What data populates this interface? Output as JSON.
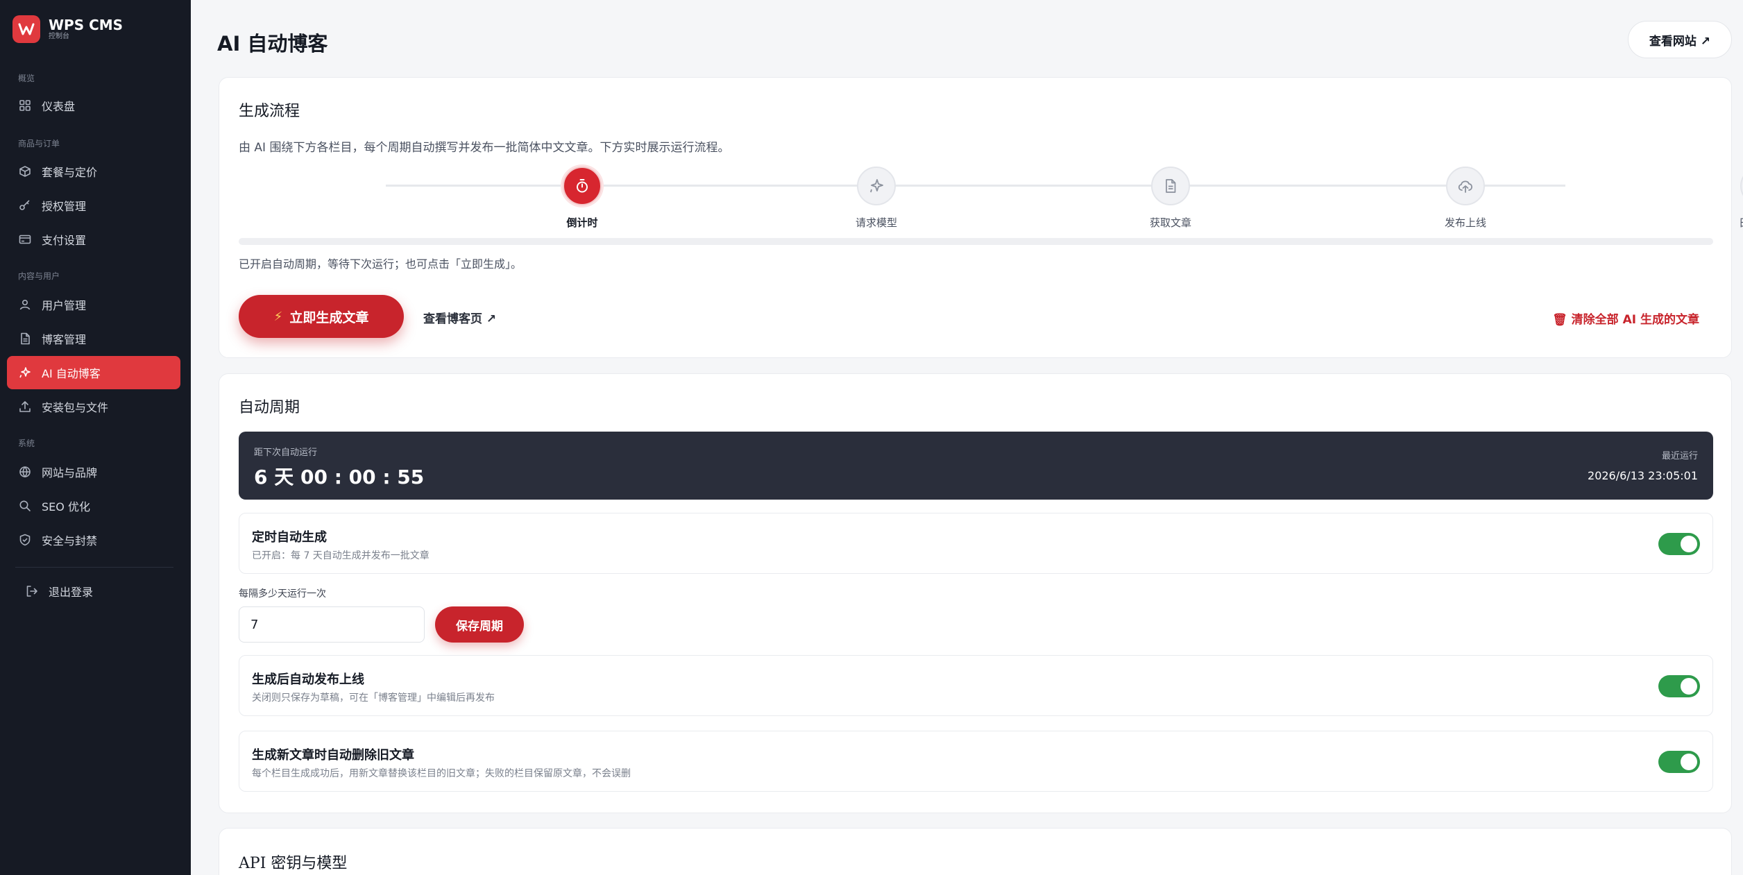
{
  "brand": {
    "name": "WPS CMS",
    "subtitle": "控制台"
  },
  "sidebar": {
    "groups": [
      "概览",
      "商品与订单",
      "内容与用户",
      "系统"
    ],
    "items": [
      {
        "label": "仪表盘",
        "icon": "dashboard-grid-icon"
      },
      {
        "label": "套餐与定价",
        "icon": "box-icon"
      },
      {
        "label": "授权管理",
        "icon": "key-icon"
      },
      {
        "label": "支付设置",
        "icon": "credit-card-icon"
      },
      {
        "label": "用户管理",
        "icon": "user-icon"
      },
      {
        "label": "博客管理",
        "icon": "document-icon"
      },
      {
        "label": "AI 自动博客",
        "icon": "sparkles-icon",
        "active": true
      },
      {
        "label": "安装包与文件",
        "icon": "upload-icon"
      },
      {
        "label": "网站与品牌",
        "icon": "globe-icon"
      },
      {
        "label": "SEO 优化",
        "icon": "search-icon"
      },
      {
        "label": "安全与封禁",
        "icon": "shield-icon"
      }
    ],
    "logout": "退出登录"
  },
  "header": {
    "title": "AI 自动博客",
    "view_site": "查看网站 ↗"
  },
  "pipeline": {
    "title": "生成流程",
    "description": "由 AI 围绕下方各栏目，每个周期自动撰写并发布一批简体中文文章。下方实时展示运行流程。",
    "steps": [
      {
        "label": "倒计时",
        "icon": "stopwatch-icon",
        "active": true
      },
      {
        "label": "请求模型",
        "icon": "sparkles-icon"
      },
      {
        "label": "获取文章",
        "icon": "document-icon"
      },
      {
        "label": "发布上线",
        "icon": "cloud-upload-icon"
      },
      {
        "label": "日志更新",
        "icon": "list-doc-icon"
      }
    ],
    "progress": 0,
    "status": "已开启自动周期，等待下次运行；也可点击「立即生成」。",
    "generate_button": "立即生成文章",
    "view_blog": "查看博客页 ↗",
    "clear_button": "🗑 清除全部 AI 生成的文章"
  },
  "schedule": {
    "title": "自动周期",
    "countdown_label": "距下次自动运行",
    "countdown_value": "6 天 00 : 00 : 55",
    "last_run_label": "最近运行",
    "last_run_value": "2026/6/13 23:05:01",
    "settings": [
      {
        "title": "定时自动生成",
        "subtitle": "已开启：每 7 天自动生成并发布一批文章",
        "enabled": true
      },
      {
        "title": "生成后自动发布上线",
        "subtitle": "关闭则只保存为草稿，可在「博客管理」中编辑后再发布",
        "enabled": true
      },
      {
        "title": "生成新文章时自动删除旧文章",
        "subtitle": "每个栏目生成成功后，用新文章替换该栏目的旧文章；失败的栏目保留原文章，不会误删",
        "enabled": true
      }
    ],
    "interval_label": "每隔多少天运行一次",
    "interval_value": "7",
    "save_button": "保存周期"
  },
  "api": {
    "title": "API 密钥与模型"
  },
  "colors": {
    "accent": "#d7262f",
    "sidebar_bg": "#161a24",
    "toggle_on": "#2e9b4b"
  }
}
